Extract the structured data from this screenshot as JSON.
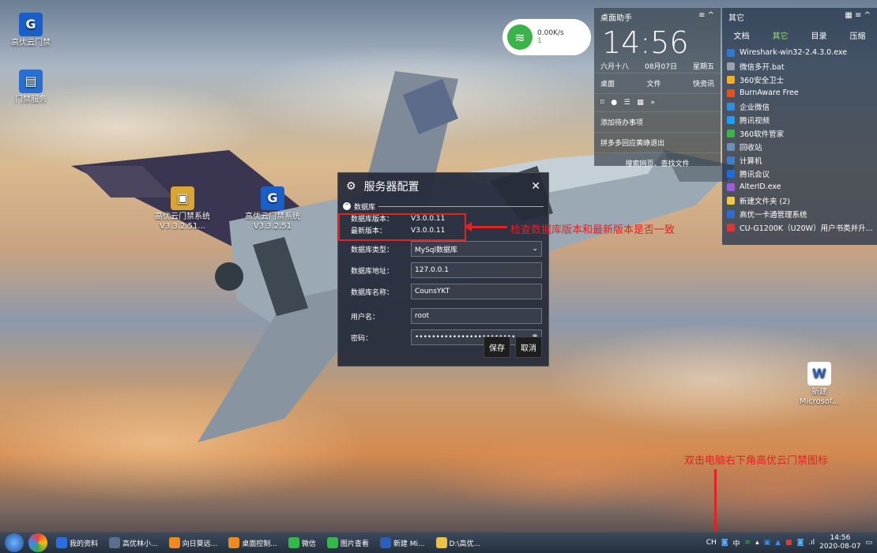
{
  "desktop_icons": [
    {
      "label": "高优云门禁"
    },
    {
      "label": "门禁服务"
    },
    {
      "label": "高优云门禁系统V3.3.2.51..."
    },
    {
      "label": "高优云门禁系统V3.3.2.51"
    },
    {
      "label": "新建 Microsof..."
    }
  ],
  "net_widget": {
    "speed": "0.00K/s",
    "count": "1"
  },
  "desktop_helper": {
    "title": "桌面助手",
    "time": "14:56",
    "lunar": "六月十八",
    "date": "08月07日",
    "weekday": "星期五",
    "tools": [
      "桌面",
      "文件",
      "快资讯"
    ],
    "todo": "添加待办事项",
    "hint": "拼多多回应黄峥退出",
    "search": "搜索网页、查找文件"
  },
  "other_panel": {
    "title": "其它",
    "tabs": [
      "文档",
      "其它",
      "目录",
      "压缩"
    ],
    "active_tab": "其它",
    "items": [
      {
        "label": "Wireshark-win32-2.4.3.0.exe",
        "color": "#2c7ad6"
      },
      {
        "label": "微信多开.bat",
        "color": "#9aa3ad"
      },
      {
        "label": "360安全卫士",
        "color": "#f2b01e"
      },
      {
        "label": "BurnAware Free",
        "color": "#e2531d"
      },
      {
        "label": "企业微信",
        "color": "#2f8fdc"
      },
      {
        "label": "腾讯视频",
        "color": "#1aa0f0"
      },
      {
        "label": "360软件管家",
        "color": "#3bb54a"
      },
      {
        "label": "回收站",
        "color": "#6b8fb8"
      },
      {
        "label": "计算机",
        "color": "#3c7fd0"
      },
      {
        "label": "腾讯会议",
        "color": "#1e6de0"
      },
      {
        "label": "AlterID.exe",
        "color": "#9a5de0"
      },
      {
        "label": "新建文件夹 (2)",
        "color": "#f2c744"
      },
      {
        "label": "高优一卡通管理系统",
        "color": "#2f6bd3"
      },
      {
        "label": "CU-G1200K（U20W）用户书类并升...",
        "color": "#e23434"
      }
    ]
  },
  "dialog": {
    "title": "服务器配置",
    "section": "数据库",
    "db_version_label": "数据库版本：",
    "db_version": "V3.0.0.11",
    "latest_version_label": "最新版本：",
    "latest_version": "V3.0.0.11",
    "fields": [
      {
        "label": "数据库类型：",
        "value": "MySql数据库"
      },
      {
        "label": "数据库地址：",
        "value": "127.0.0.1"
      },
      {
        "label": "数据库名称：",
        "value": "CounsYKT"
      },
      {
        "label": "用户名：",
        "value": "root"
      },
      {
        "label": "密码：",
        "value": "••••••••••••••••••••••••"
      }
    ],
    "save_label": "保存",
    "cancel_label": "取消"
  },
  "annotations": {
    "note1": "检查数据库版本和最新版本是否一致",
    "note2": "双击电脑右下角高优云门禁图标"
  },
  "taskbar": {
    "items": [
      {
        "label": "我的资料",
        "color": "#2c6ee0"
      },
      {
        "label": "高优林小...",
        "color": "#5b6f8a"
      },
      {
        "label": "向日葵远...",
        "color": "#f08a1c"
      },
      {
        "label": "桌面控制...",
        "color": "#f08a1c"
      },
      {
        "label": "微信",
        "color": "#35b84a"
      },
      {
        "label": "图片查看",
        "color": "#35b84a"
      },
      {
        "label": "新建 Mi...",
        "color": "#2b5fb8"
      },
      {
        "label": "D:\\高优...",
        "color": "#e8c24a"
      }
    ],
    "tray_lang": "CH",
    "tray_ime": "中",
    "time": "14:56",
    "date": "2020-08-07"
  }
}
